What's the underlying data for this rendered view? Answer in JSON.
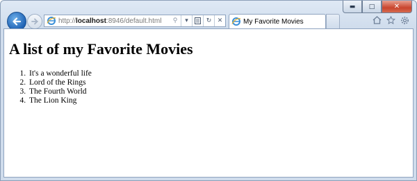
{
  "browser": {
    "address_bar": {
      "url_prefix": "http://",
      "url_host": "localhost",
      "url_rest": ":8946/default.html"
    },
    "tab": {
      "title": "My Favorite Movies"
    }
  },
  "page": {
    "heading": "A list of my Favorite Movies",
    "movies": [
      "It's a wonderful life",
      "Lord of the Rings",
      "The Fourth World",
      "The Lion King"
    ]
  },
  "icons": {
    "back": "back-arrow-icon",
    "forward": "forward-arrow-icon",
    "page": "ie-page-icon",
    "search": "search-icon",
    "dropdown": "dropdown-arrow-icon",
    "compat": "compatibility-view-icon",
    "refresh": "refresh-icon",
    "stop": "stop-icon",
    "home": "home-icon",
    "favorites": "favorites-star-icon",
    "tools": "gear-icon"
  },
  "colors": {
    "accent": "#1e62b4",
    "frame": "#cfdcec"
  }
}
